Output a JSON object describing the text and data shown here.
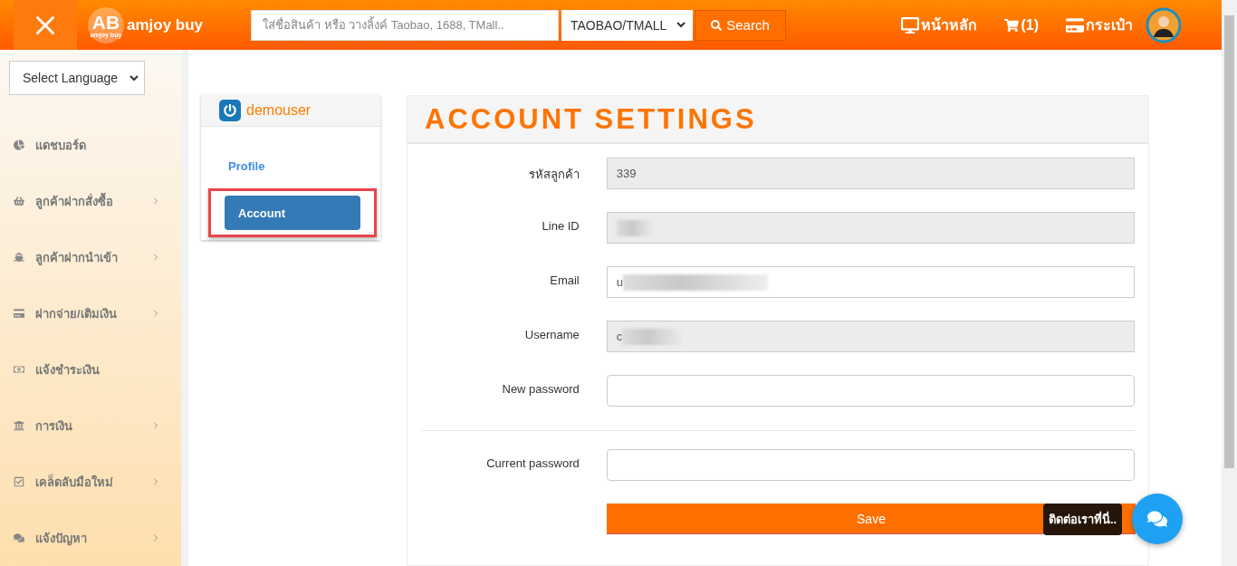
{
  "header": {
    "logo": {
      "mark": "AB",
      "tagline": "amjoy buy",
      "name": "amjoy buy"
    },
    "search": {
      "placeholder": "ใส่ชื่อสินค้า หรือ วางลิ้งค์ Taobao, 1688, TMall.."
    },
    "source_select": {
      "value": "TAOBAO/TMALL"
    },
    "search_button": "Search",
    "nav": [
      {
        "label": "หน้าหลัก"
      },
      {
        "label": "(1)"
      },
      {
        "label": "กระเป๋า"
      }
    ]
  },
  "sidebar": {
    "language_select": {
      "value": "Select Language"
    },
    "items": [
      {
        "label": "แดชบอร์ด",
        "submenu": false
      },
      {
        "label": "ลูกค้าฝากสั่งซื้อ",
        "submenu": true
      },
      {
        "label": "ลูกค้าฝากนำเข้า",
        "submenu": true
      },
      {
        "label": "ฝากจ่าย/เติมเงิน",
        "submenu": true
      },
      {
        "label": "แจ้งชำระเงิน",
        "submenu": false
      },
      {
        "label": "การเงิน",
        "submenu": true
      },
      {
        "label": "เคล็ดลับมือใหม่",
        "submenu": true
      },
      {
        "label": "แจ้งปัญหา",
        "submenu": true
      }
    ]
  },
  "user_card": {
    "username": "demouser",
    "menu": [
      {
        "label": "Profile",
        "selected": false
      },
      {
        "label": "Account",
        "selected": true
      }
    ]
  },
  "settings": {
    "title": "ACCOUNT SETTINGS",
    "fields": [
      {
        "label": "รหัสลูกค้า",
        "value": "339",
        "readonly": true,
        "redacted": false
      },
      {
        "label": "Line ID",
        "readonly": true,
        "redacted": true
      },
      {
        "label": "Email",
        "value": "u",
        "readonly": false,
        "redacted": true
      },
      {
        "label": "Username",
        "value": "c",
        "readonly": true,
        "redacted": true
      },
      {
        "label": "New password",
        "readonly": false,
        "redacted": false
      }
    ],
    "confirm_field": {
      "label": "Current password"
    },
    "save_button": "Save"
  },
  "chat": {
    "tooltip": "ติดต่อเราที่นี่.."
  }
}
